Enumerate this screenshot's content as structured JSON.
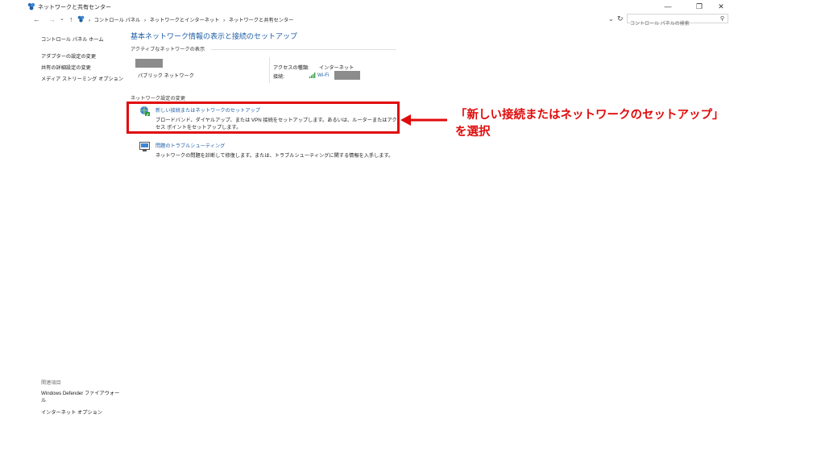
{
  "window": {
    "title": "ネットワークと共有センター",
    "controls": {
      "minimize": "—",
      "maximize": "❐",
      "close": "✕"
    }
  },
  "address_bar": {
    "back": "←",
    "forward": "→",
    "recent": "⌄",
    "up": "↑",
    "breadcrumbs": [
      "コントロール パネル",
      "ネットワークとインターネット",
      "ネットワークと共有センター"
    ],
    "separator": "›",
    "dropdown": "⌄",
    "refresh": "↻"
  },
  "search": {
    "placeholder": "コントロール パネルの検索",
    "icon": "⚲"
  },
  "sidebar": {
    "home": "コントロール パネル ホーム",
    "links": [
      "アダプターの設定の変更",
      "共有の詳細設定の変更",
      "メディア ストリーミング オプション"
    ],
    "related_heading": "関連項目",
    "related": [
      "Windows Defender ファイアウォール",
      "インターネット オプション"
    ]
  },
  "main": {
    "title": "基本ネットワーク情報の表示と接続のセットアップ",
    "active_networks_heading": "アクティブなネットワークの表示",
    "network_type": "パブリック ネットワーク",
    "access_type_label": "アクセスの種類:",
    "access_type_value": "インターネット",
    "connection_label": "接続:",
    "connection_value": "Wi-Fi",
    "change_settings_heading": "ネットワーク設定の変更",
    "setup": {
      "link": "新しい接続またはネットワークのセットアップ",
      "description": "ブロードバンド、ダイヤルアップ、または VPN 接続をセットアップします。あるいは、ルーターまたはアクセス ポイントをセットアップします。"
    },
    "troubleshoot": {
      "link": "問題のトラブルシューティング",
      "description": "ネットワークの問題を診断して修復します。または、トラブルシューティングに関する情報を入手します。"
    }
  },
  "annotation": {
    "line1": "「新しい接続またはネットワークのセットアップ」",
    "line2": "を選択",
    "color": "#e00b0b"
  },
  "colors": {
    "link": "#1f5fa6",
    "accent_red": "#e00b0b"
  }
}
